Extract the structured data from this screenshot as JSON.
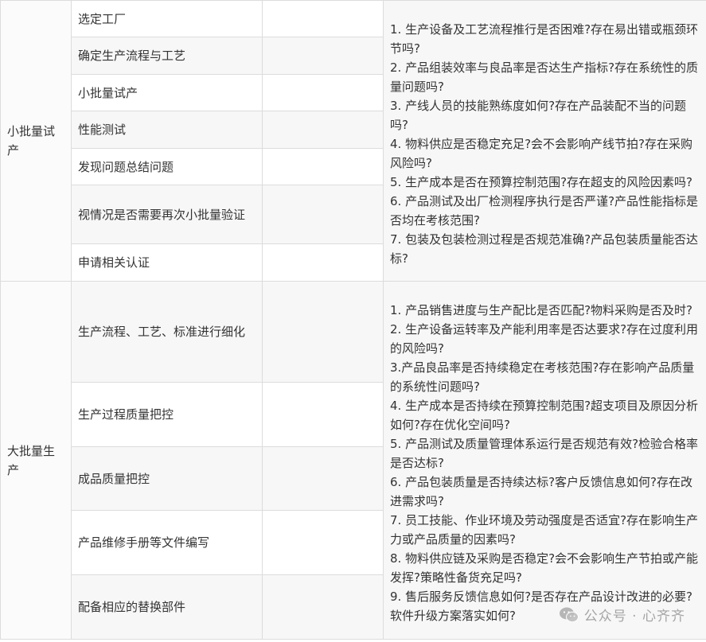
{
  "sections": [
    {
      "phase": "小批量试产",
      "steps": [
        "选定工厂",
        "确定生产流程与工艺",
        "小批量试产",
        "性能测试",
        "发现问题总结问题",
        "视情况是否需要再次小批量验证",
        "申请相关认证"
      ],
      "questions": [
        "1. 生产设备及工艺流程推行是否困难?存在易出错或瓶颈环节吗?",
        "2. 产品组装效率与良品率是否达生产指标?存在系统性的质量问题吗?",
        "3. 产线人员的技能熟练度如何?存在产品装配不当的问题吗?",
        "4. 物料供应是否稳定充足?会不会影响产线节拍?存在采购风险吗?",
        "5. 生产成本是否在预算控制范围?存在超支的风险因素吗?",
        "6. 产品测试及出厂检测程序执行是否严谨?产品性能指标是否均在考核范围?",
        "7. 包装及包装检测过程是否规范准确?产品包装质量能否达标?"
      ]
    },
    {
      "phase": "大批量生产",
      "steps": [
        "生产流程、工艺、标准进行细化",
        "生产过程质量把控",
        "成品质量把控",
        "产品维修手册等文件编写",
        "配备相应的替换部件"
      ],
      "questions": [
        "1. 产品销售进度与生产配比是否匹配?物料采购是否及时?",
        "2. 生产设备运转率及产能利用率是否达要求?存在过度利用的风险吗?",
        "3.产品良品率是否持续稳定在考核范围?存在影响产品质量的系统性问题吗?",
        "4. 生产成本是否持续在预算控制范围?超支项目及原因分析如何?存在优化空间吗?",
        "5. 产品测试及质量管理体系运行是否规范有效?检验合格率是否达标?",
        "6. 产品包装质量是否持续达标?客户反馈信息如何?存在改进需求吗?",
        "7. 员工技能、作业环境及劳动强度是否适宜?存在影响生产力或产品质量的因素吗?",
        "8. 物料供应链及采购是否稳定?会不会影响生产节拍或产能发挥?策略性备货充足吗?",
        "9. 售后服务反馈信息如何?是否存在产品设计改进的必要?软件升级方案落实如何?"
      ]
    }
  ],
  "watermark": {
    "text": "公众号 · 心齐齐",
    "icon": "wechat-icon"
  }
}
